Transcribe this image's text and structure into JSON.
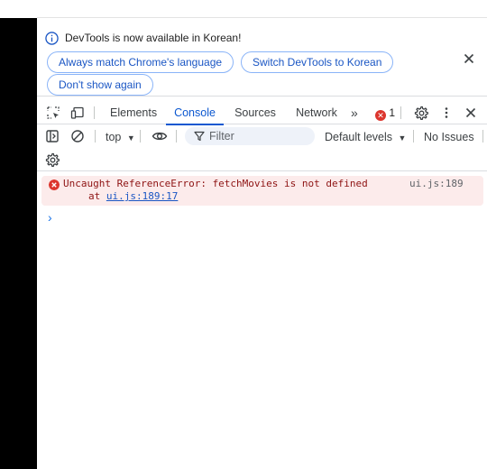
{
  "infobar": {
    "message": "DevTools is now available in Korean!",
    "buttons": [
      "Always match Chrome's language",
      "Switch DevTools to Korean",
      "Don't show again"
    ]
  },
  "tabs": {
    "items": [
      "Elements",
      "Console",
      "Sources",
      "Network"
    ],
    "active": "Console",
    "more": "»",
    "error_count": "1"
  },
  "console_toolbar": {
    "context": "top",
    "filter_placeholder": "Filter",
    "levels": "Default levels",
    "issues": "No Issues"
  },
  "messages": [
    {
      "level": "error",
      "text": "Uncaught ReferenceError: fetchMovies is not defined",
      "stack_prefix": "at ",
      "stack_link": "ui.js:189:17",
      "source": "ui.js:189"
    }
  ],
  "prompt": "›",
  "colors": {
    "accent": "#0b57d0",
    "error": "#dc362e",
    "error_bg": "#fcebeb"
  },
  "icons": [
    "info-icon",
    "close-icon",
    "inspect-element-icon",
    "device-toolbar-icon",
    "settings-icon",
    "more-vert-icon",
    "sidebar-icon",
    "clear-icon",
    "eye-icon",
    "filter-icon"
  ]
}
